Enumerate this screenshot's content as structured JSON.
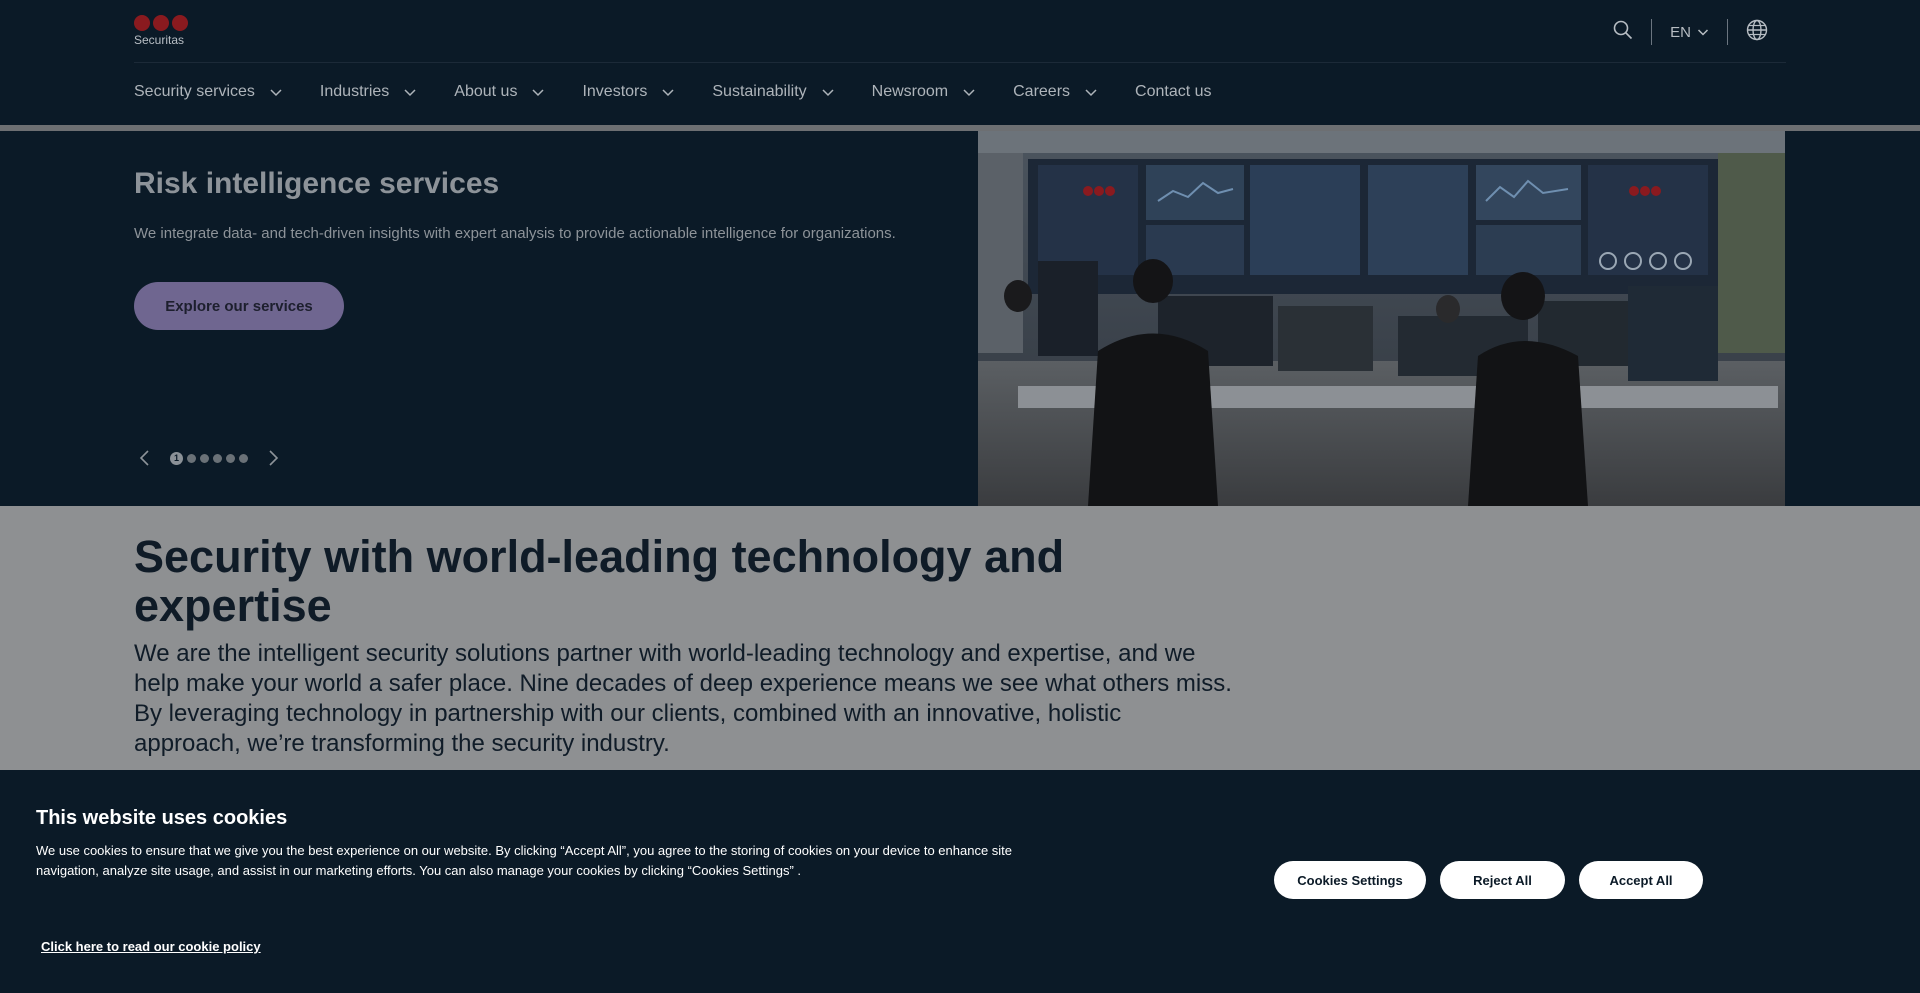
{
  "brand": {
    "name": "Securitas",
    "logo_color": "#8a1a1f"
  },
  "header": {
    "language": "EN",
    "icons": [
      "search-icon",
      "chevron-down-icon",
      "globe-icon"
    ],
    "nav": [
      {
        "label": "Security services",
        "has_dropdown": true
      },
      {
        "label": "Industries",
        "has_dropdown": true
      },
      {
        "label": "About us",
        "has_dropdown": true
      },
      {
        "label": "Investors",
        "has_dropdown": true
      },
      {
        "label": "Sustainability",
        "has_dropdown": true
      },
      {
        "label": "Newsroom",
        "has_dropdown": true
      },
      {
        "label": "Careers",
        "has_dropdown": true
      },
      {
        "label": "Contact us",
        "has_dropdown": false
      }
    ]
  },
  "hero": {
    "title": "Risk intelligence services",
    "subtitle": "We integrate data- and tech-driven insights with expert analysis to provide actionable intelligence for organizations.",
    "button": "Explore our services",
    "carousel": {
      "current": "1",
      "total_slides": 6
    },
    "image": {
      "content": "security-operations-center-photo",
      "logos": [
        "Securitas",
        "Securitas"
      ]
    }
  },
  "main": {
    "title": "Security with world-leading technology and expertise",
    "paragraph": "We are the intelligent security solutions partner with world-leading technology and expertise, and we help make your world a safer place. Nine decades of deep experience means we see what others miss. By leveraging technology in partnership with our clients, combined with an innovative, holistic approach, we’re transforming the security industry."
  },
  "cookie": {
    "title": "This website uses cookies",
    "text": "We use cookies to ensure that we give you the best experience on our website. By clicking “Accept All”, you agree to the storing of cookies on your device to enhance site navigation, analyze site usage, and assist in our marketing efforts. You can also manage your cookies by clicking “Cookies Settings” .",
    "settings_button": "Cookies Settings",
    "reject_button": "Reject All",
    "accept_button": "Accept All",
    "policy_link": "Click here to read our cookie policy"
  },
  "colors": {
    "background": "#0b1a27",
    "overlay_gray": "#8e9092",
    "hero_button": "#6f6690",
    "cookie_button": "#ffffff"
  }
}
